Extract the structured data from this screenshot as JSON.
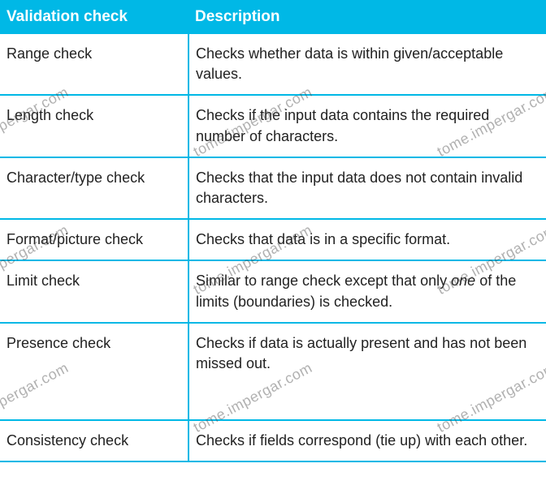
{
  "table": {
    "headers": {
      "validation": "Validation check",
      "description": "Description"
    },
    "rows": [
      {
        "validation": "Range check",
        "description": "Checks whether data is within given/acceptable values."
      },
      {
        "validation": "Length check",
        "description": "Checks if the input data contains the required number of characters."
      },
      {
        "validation": "Character/type check",
        "description": "Checks that the input data does not contain invalid characters."
      },
      {
        "validation": "Format/picture check",
        "description": "Checks that data is in a specific format."
      },
      {
        "validation": "Limit check",
        "description_prefix": "Similar to range check except that only ",
        "description_em": "one",
        "description_suffix": " of the limits (boundaries) is checked."
      },
      {
        "validation": "Presence check",
        "description": "Checks if data is actually present and has not been missed out."
      },
      {
        "validation": "Consistency check",
        "description": "Checks if fields correspond (tie up) with each other."
      }
    ]
  },
  "watermark_text": "tome.impergar.com"
}
